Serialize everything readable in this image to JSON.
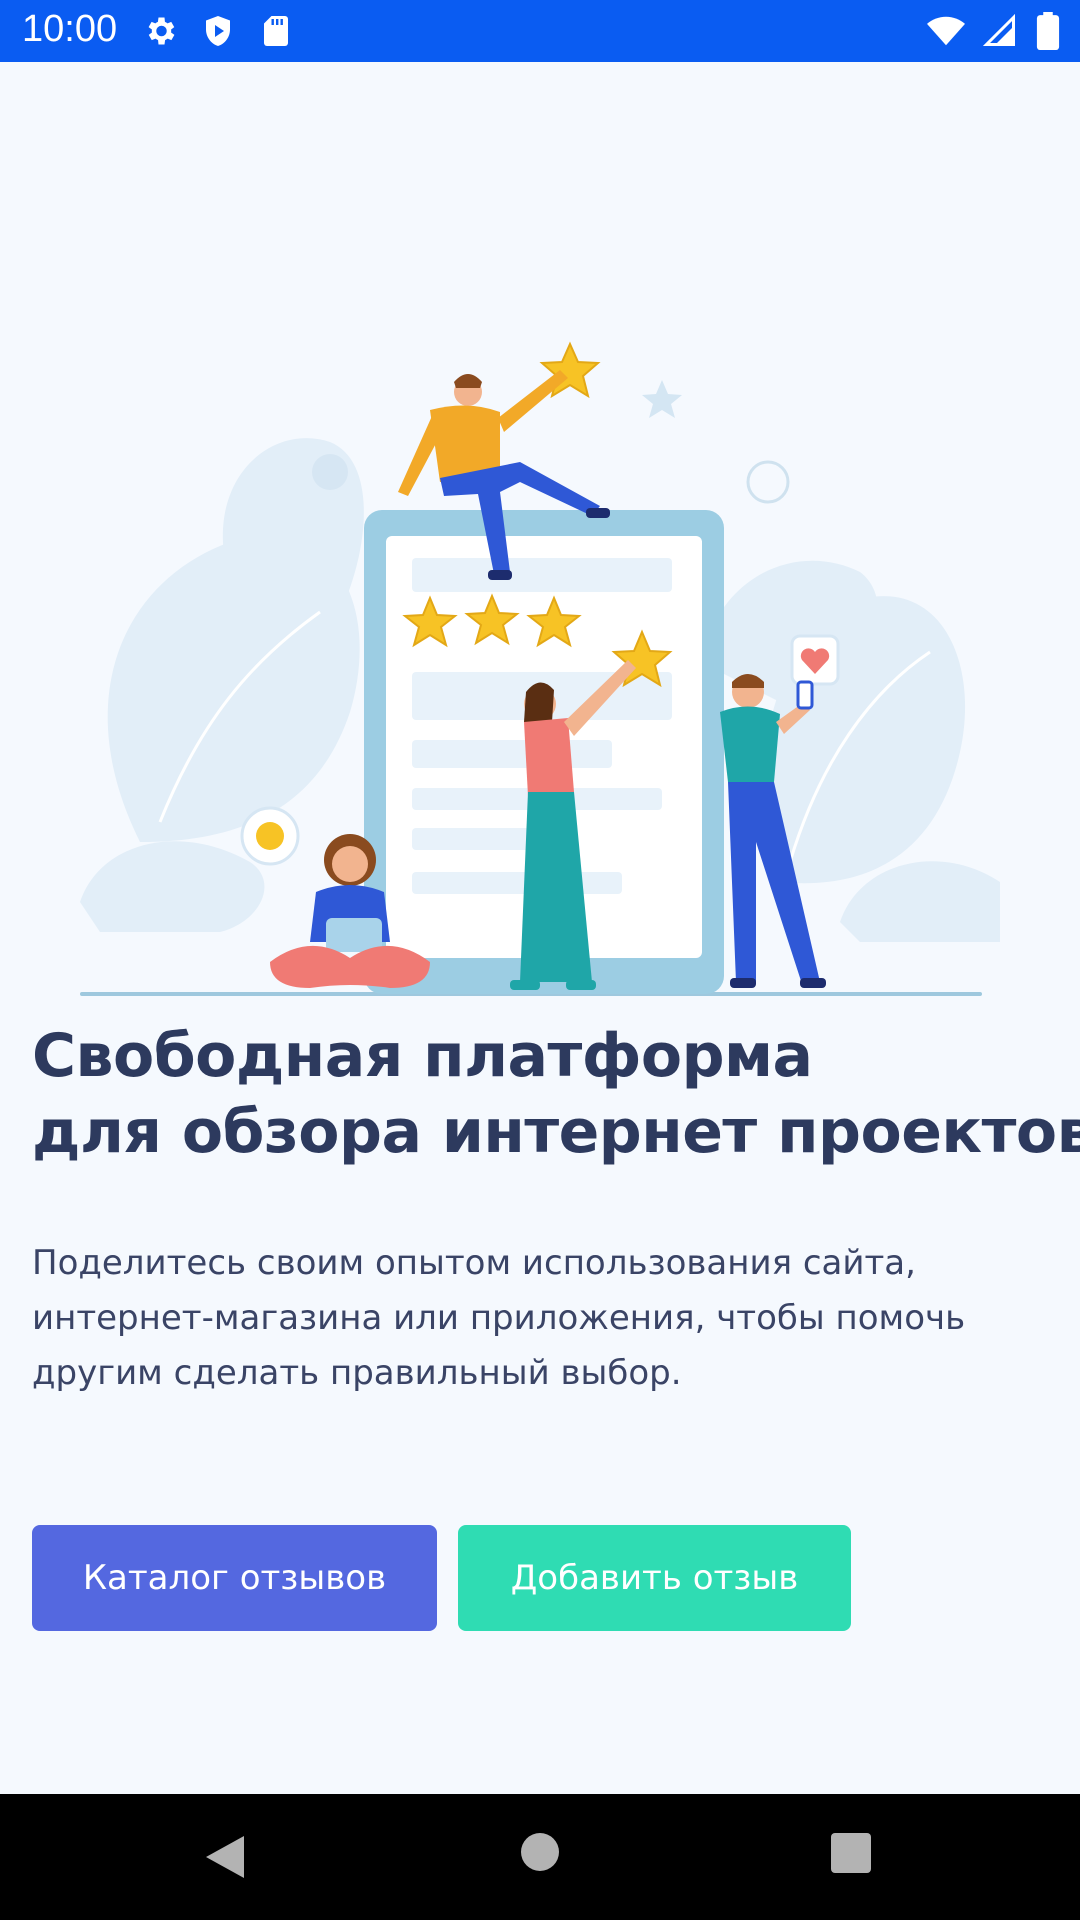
{
  "status_bar": {
    "time": "10:00",
    "left_icons": [
      "gear-icon",
      "shield-play-icon",
      "sd-card-icon"
    ],
    "right_icons": [
      "wifi-icon",
      "signal-icon",
      "battery-icon"
    ],
    "background": "#0a5cf2"
  },
  "hero": {
    "illustration": "people-rating-with-stars-illustration"
  },
  "main": {
    "title_line1": "Свободная платформа",
    "title_line2": "для обзора интернет проектов",
    "description_line1": "Поделитесь своим опытом использования сайта,",
    "description_line2": "интернет-магазина или приложения, чтобы помочь",
    "description_line3": "другим сделать правильный выбор.",
    "title_color": "#2d3a5e"
  },
  "buttons": {
    "catalog_label": "Каталог отзывов",
    "catalog_color": "#5468e0",
    "add_review_label": "Добавить отзыв",
    "add_review_color": "#2fdcb3"
  },
  "nav_bar": {
    "items": [
      "back-icon",
      "home-icon",
      "recents-icon"
    ]
  }
}
